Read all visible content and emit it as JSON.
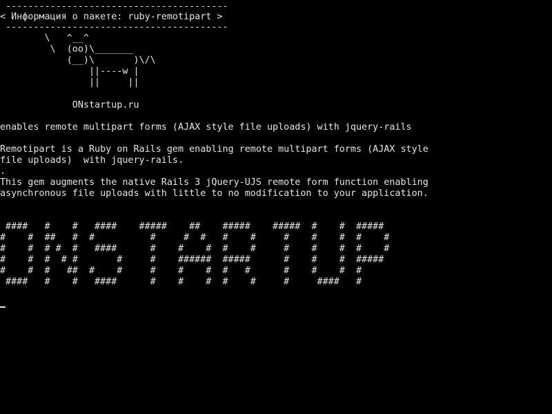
{
  "terminal": {
    "colors": {
      "background": "#000000",
      "foreground": "#e6e6e6"
    },
    "banner": {
      "top_rule": " ----------------------------------------",
      "title": "< Информация о пакете: ruby-remotipart >",
      "bottom_rule": " ----------------------------------------"
    },
    "cow": [
      "        \\   ^__^",
      "         \\  (oo)\\_______",
      "            (__)\\       )\\/\\",
      "                ||----w |",
      "                ||     ||"
    ],
    "site": "             ONstartup.ru",
    "summary": "enables remote multipart forms (AJAX style file uploads) with jquery-rails",
    "description": [
      "Remotipart is a Ruby on Rails gem enabling remote multipart forms (AJAX style",
      "file uploads)  with jquery-rails.",
      ".",
      "This gem augments the native Rails 3 jQuery-UJS remote form function enabling",
      "asynchronous file uploads with little to no modification to your application."
    ],
    "big_text": [
      " ####   #    #   ####    #####    ##    #####    #####  #    #  #####",
      "#    #  ##   #  #          #     #  #   #    #     #    #    #  #    #",
      "#    #  # #  #   ####      #    #    #  #    #     #    #    #  #    #",
      "#    #  #  # #       #     #    ######  #####      #    #    #  #####",
      "#    #  #   ##  #    #     #    #    #  #   #      #    #    #  #",
      " ####   #    #   ####      #    #    #  #    #     #     ####   #"
    ]
  }
}
